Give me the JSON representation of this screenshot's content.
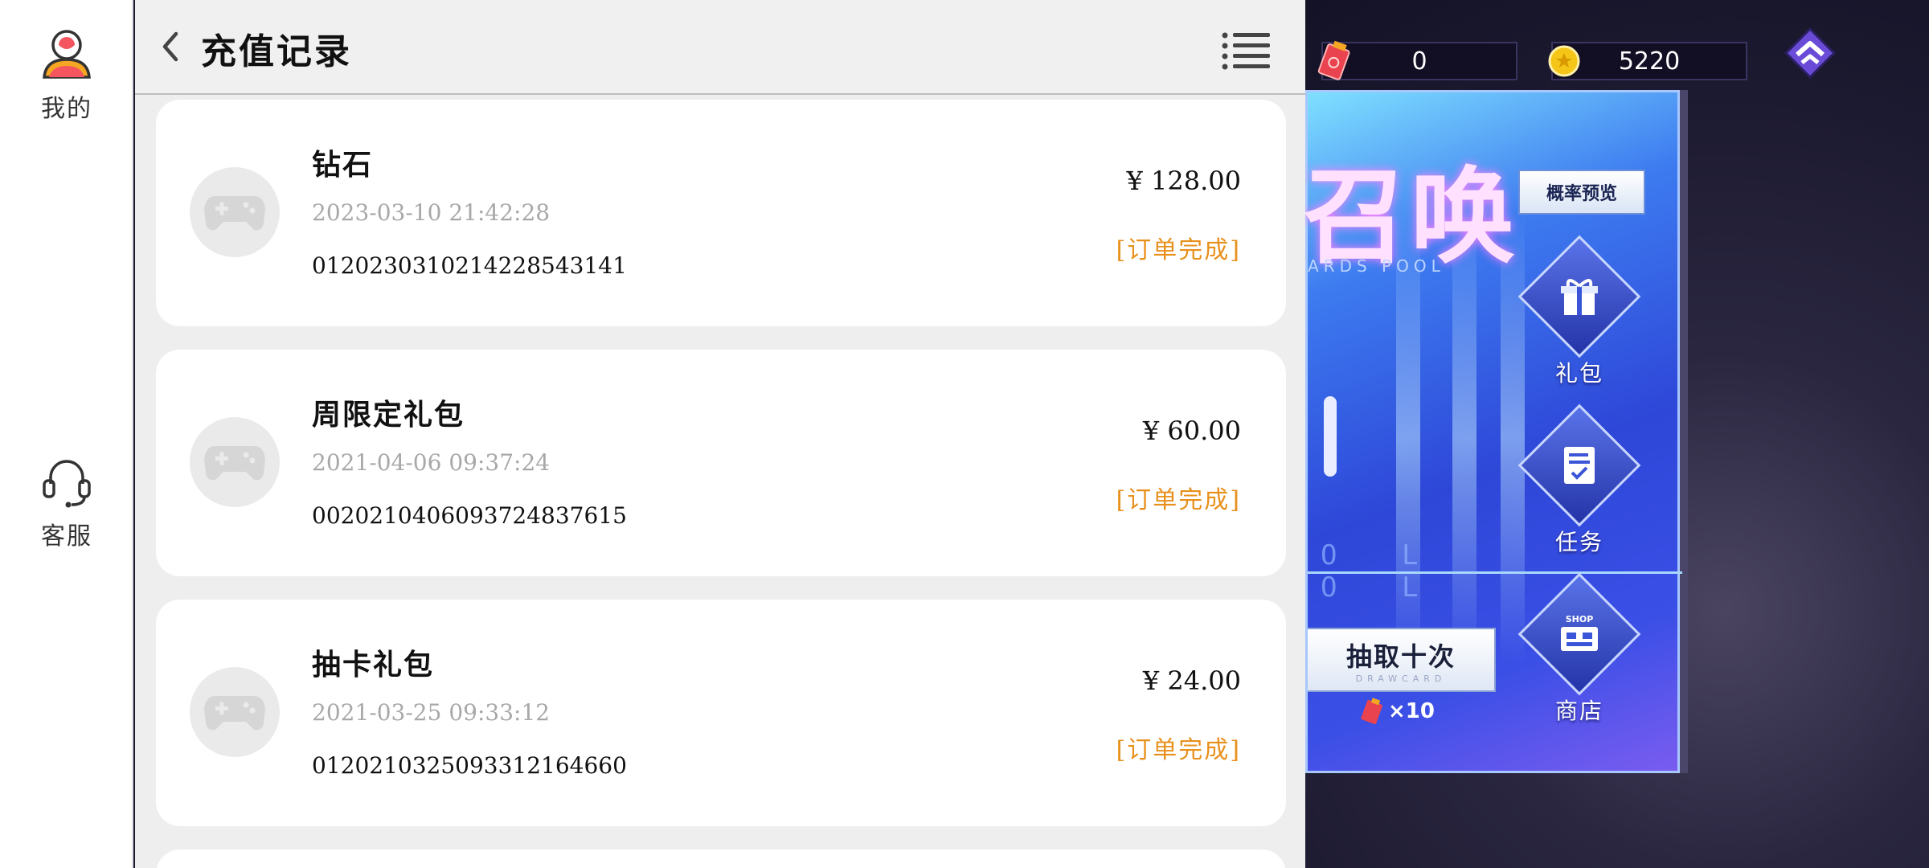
{
  "sidebar": {
    "me_label": "我的",
    "service_label": "客服"
  },
  "header": {
    "title": "充值记录"
  },
  "records": [
    {
      "name": "钻石",
      "time": "2023-03-10  21:42:28",
      "order_no": "0120230310214228543141",
      "price": "¥ 128.00",
      "status": "[订单完成]"
    },
    {
      "name": "周限定礼包",
      "time": "2021-04-06  09:37:24",
      "order_no": "0020210406093724837615",
      "price": "¥ 60.00",
      "status": "[订单完成]"
    },
    {
      "name": "抽卡礼包",
      "time": "2021-03-25  09:33:12",
      "order_no": "0120210325093312164660",
      "price": "¥ 24.00",
      "status": "[订单完成]"
    }
  ],
  "game": {
    "tickets": "0",
    "coins": "5220",
    "pool_title": "召唤",
    "pool_subtitle": "ARDS POOL",
    "rate_preview": "概率预览",
    "ghost_text_1": "O L",
    "ghost_text_2": "O L",
    "gift_label": "礼包",
    "task_label": "任务",
    "shop_label": "商店",
    "shop_icon_text": "SHOP",
    "draw_ten_label": "抽取十次",
    "draw_ten_sub": "DRAWCARD",
    "draw_cost": "×10"
  },
  "colors": {
    "status": "#e8901c",
    "time_text": "#a8a8a8",
    "pool_blue": "#2e47d8"
  }
}
